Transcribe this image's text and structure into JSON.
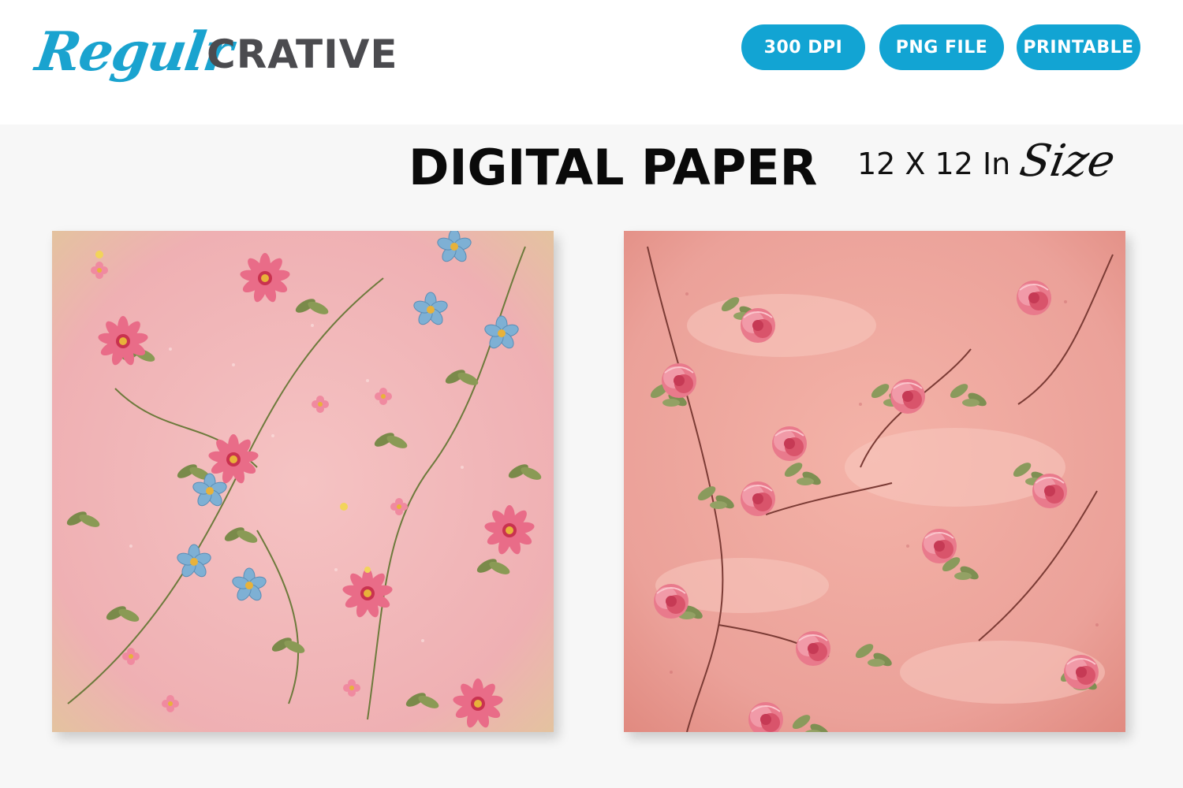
{
  "brand": {
    "logo_script": "Regulr",
    "logo_bold": "CRATIVE",
    "script_color": "#1aa3cf",
    "bold_color": "#4b4b4f"
  },
  "badges": [
    {
      "label": "300 DPI"
    },
    {
      "label": "PNG FILE"
    },
    {
      "label": "PRINTABLE"
    }
  ],
  "badge_color": "#12a4d3",
  "heading": {
    "title": "DIGITAL PAPER",
    "size_text": "12 X 12 In",
    "size_script": "Size"
  },
  "papers": [
    {
      "style": "vintage pink floral with blue and red flowers",
      "background": "#f2b6b8"
    },
    {
      "style": "distressed coral rose floral",
      "background": "#eea49d"
    }
  ]
}
